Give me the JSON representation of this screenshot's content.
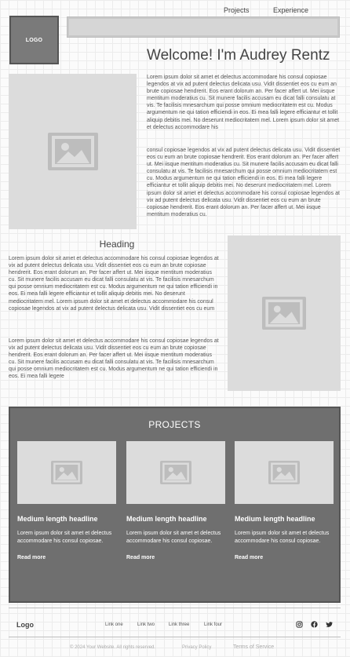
{
  "header": {
    "logo_text": "LOGO",
    "nav": [
      {
        "label": "Projects"
      },
      {
        "label": "Experience"
      }
    ]
  },
  "hero": {
    "title": "Welcome! I'm Audrey Rentz",
    "image_icon": "image-placeholder-icon",
    "paragraphs": [
      "Lorem ipsum dolor sit amet et delectus accommodare his consul copiosae legendos at vix ad putent delectus delicata usu. Vidit dissentiet eos cu eum an brute copiosae hendrerit. Eos erant dolorum an. Per facer affert ut. Mei iisque mentitum moderatius cu. Sit munere facilis accusam eu dicat falli consulatu at vis. Te facilisis mnesarchum qui posse omnium mediocritatem est cu. Modus argumentum ne qui tation efficiendi in eos. Ei mea falli legere efficiantur et tollit aliquip debitis mei. No deserunt mediocritatem mel. Lorem ipsum dolor sit amet et delectus accommodare his",
      "consul copiosae legendos at vix ad putent delectus delicata usu. Vidit dissentiet eos cu eum an brute copiosae hendrerit. Eos erant dolorum an. Per facer affert ut. Mei iisque mentitum moderatius cu. Sit munere facilis accusam eu dicat falli consulatu at vis. Te facilisis mnesarchum qui posse omnium mediocritatem est cu. Modus argumentum ne qui tation efficiendi in eos. Ei mea falli legere efficiantur et tollit aliquip debitis mei. No deserunt mediocritatem mel. Lorem ipsum dolor sit amet et delectus accommodare his consul copiosae legendos at vix ad putent delectus delicata usu. Vidit dissentiet eos cu eum an brute copiosae hendrerit. Eos erant dolorum an. Per facer affert ut. Mei iisque mentitum moderatius cu."
    ]
  },
  "about": {
    "heading": "Heading",
    "paragraphs": [
      "Lorem ipsum dolor sit amet et delectus accommodare his consul copiosae legendos at vix ad putent delectus delicata usu. Vidit dissentiet eos cu eum an brute copiosae hendrerit. Eos erant dolorum an. Per facer affert ut. Mei iisque mentitum moderatius cu. Sit munere facilis accusam eu dicat falli consulatu at vis. Te facilisis mnesarchum qui posse omnium mediocritatem est cu. Modus argumentum ne qui tation efficiendi in eos. Ei mea falli legere efficiantur et tollit aliquip debitis mei. No deserunt mediocritatem mel. Lorem ipsum dolor sit amet et delectus accommodare his consul copiosae legendos at vix ad putent delectus delicata usu. Vidit dissentiet eos cu eum",
      "Lorem ipsum dolor sit amet et delectus accommodare his consul copiosae legendos at vix ad putent delectus delicata usu. Vidit dissentiet eos cu eum an brute copiosae hendrerit. Eos erant dolorum an. Per facer affert ut. Mei iisque mentitum moderatius cu. Sit munere facilis accusam eu dicat falli consulatu at vis. Te facilisis mnesarchum qui posse omnium mediocritatem est cu. Modus argumentum ne qui tation efficiendi in eos. Ei mea falli legere"
    ],
    "image_icon": "image-placeholder-icon"
  },
  "projects": {
    "title": "PROJECTS",
    "cards": [
      {
        "headline": "Medium length headline",
        "description": "Lorem ipsum dolor sit amet et delectus accommodare his consul copiosae.",
        "link": "Read more"
      },
      {
        "headline": "Medium length headline",
        "description": "Lorem ipsum dolor sit amet et delectus accommodare his consul copiosae.",
        "link": "Read more"
      },
      {
        "headline": "Medium length headline",
        "description": "Lorem ipsum dolor sit amet et delectus accommodare his consul copiosae.",
        "link": "Read more"
      }
    ]
  },
  "footer": {
    "logo": "Logo",
    "links": [
      {
        "label": "Link one"
      },
      {
        "label": "Link two"
      },
      {
        "label": "Link three"
      },
      {
        "label": "Link four"
      }
    ],
    "social_icons": [
      "instagram-icon",
      "facebook-icon",
      "twitter-icon"
    ],
    "copyright": "© 2024 Your Website. All rights reserved.",
    "privacy": "Privacy Policy",
    "terms": "Terms of Service"
  },
  "colors": {
    "panel": "#6f6f6f",
    "placeholder": "#dcdcdc",
    "placeholder_icon": "#bdbdbd"
  }
}
